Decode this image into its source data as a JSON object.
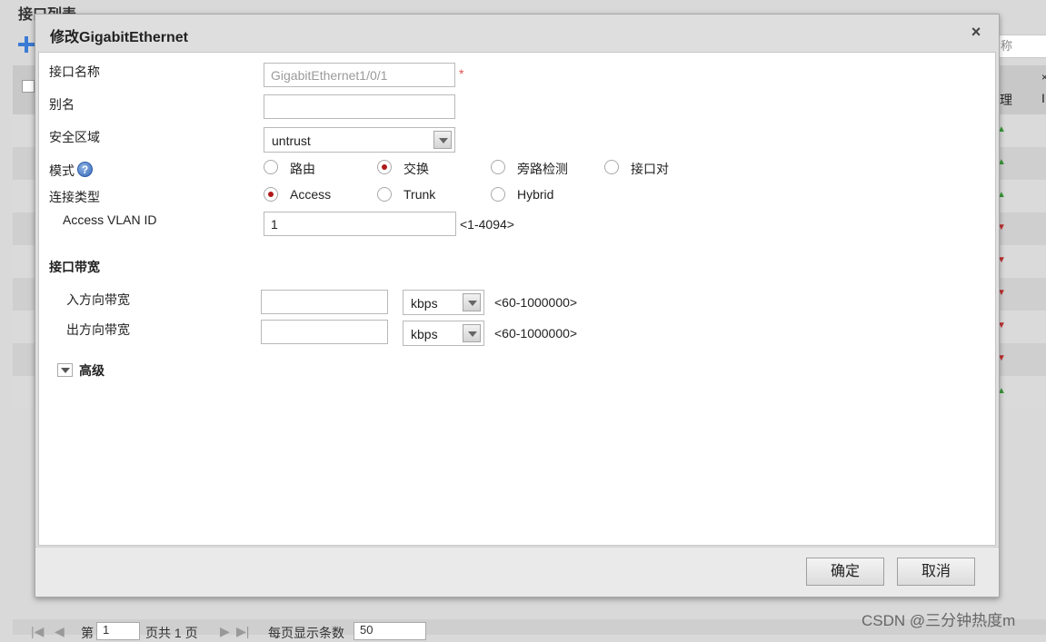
{
  "background": {
    "page_title": "接口列表",
    "search_placeholder_fragment": "称",
    "header_fragments": [
      "理",
      "I"
    ],
    "pager": {
      "label_page": "第",
      "page_value": "1",
      "label_total": "页共 1 页",
      "label_per_page": "每页显示条数",
      "per_page_value": "50"
    }
  },
  "dialog": {
    "title": "修改GigabitEthernet",
    "close_label": "×",
    "fields": {
      "interface_name": {
        "label": "接口名称",
        "value": "GigabitEthernet1/0/1",
        "required_mark": "*"
      },
      "alias": {
        "label": "别名",
        "value": ""
      },
      "security_zone": {
        "label": "安全区域",
        "selected": "untrust"
      },
      "mode": {
        "label": "模式",
        "help_icon_text": "?",
        "options": [
          "路由",
          "交换",
          "旁路检测",
          "接口对"
        ],
        "selected": "交换"
      },
      "link_type": {
        "label": "连接类型",
        "options": [
          "Access",
          "Trunk",
          "Hybrid"
        ],
        "selected": "Access"
      },
      "access_vlan": {
        "label": "Access VLAN ID",
        "value": "1",
        "range": "<1-4094>"
      }
    },
    "bandwidth": {
      "section_label": "接口带宽",
      "inbound": {
        "label": "入方向带宽",
        "value": "",
        "unit": "kbps",
        "range": "<60-1000000>"
      },
      "outbound": {
        "label": "出方向带宽",
        "value": "",
        "unit": "kbps",
        "range": "<60-1000000>"
      }
    },
    "advanced": {
      "label": "高级"
    },
    "buttons": {
      "ok": "确定",
      "cancel": "取消"
    }
  },
  "watermark": "CSDN @三分钟热度m"
}
